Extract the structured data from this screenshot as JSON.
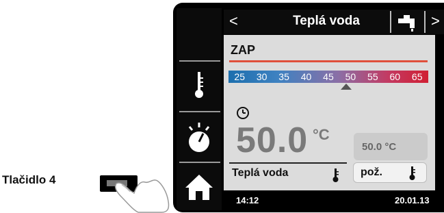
{
  "header": {
    "prev_icon": "chevron-left-icon",
    "prev_glyph": "<",
    "title": "Teplá voda",
    "tap_icon": "faucet-icon",
    "next_icon": "chevron-right-icon",
    "next_glyph": ">"
  },
  "sidebar": {
    "items": [
      {
        "icon": "thermometer-icon"
      },
      {
        "icon": "dial-icon"
      },
      {
        "icon": "home-icon"
      }
    ]
  },
  "main": {
    "mode": "ZAP",
    "scale": [
      "25",
      "30",
      "35",
      "40",
      "45",
      "50",
      "55",
      "60",
      "65"
    ],
    "current_temp": "50.0",
    "current_unit": "°C",
    "setpoint": "50.0 °C",
    "bottom_label": "Teplá voda",
    "bottom_button": "pož."
  },
  "status": {
    "time": "14:12",
    "date": "20.01.13"
  },
  "button_caption": "Tlačidlo 4",
  "colors": {
    "accent_red": "#e0503b",
    "scale_blue": "#1c6fae",
    "scale_red": "#d01f33",
    "panel": "#dcdcdc"
  }
}
